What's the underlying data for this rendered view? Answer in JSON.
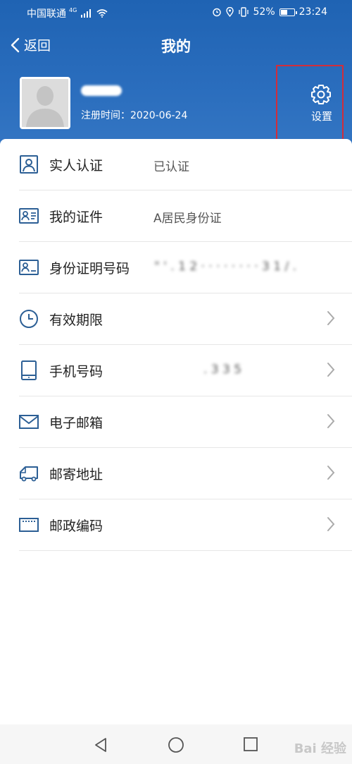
{
  "status_bar": {
    "carrier": "中国联通",
    "network": "4G",
    "battery": "52%",
    "time": "23:24",
    "battery_level": 0.52
  },
  "header": {
    "back_label": "返回",
    "title": "我的",
    "settings_label": "设置"
  },
  "profile": {
    "reg_label": "注册时间：",
    "reg_date": "2020-06-24"
  },
  "menu": [
    {
      "label": "实人认证",
      "value": "已认证",
      "icon": "person-badge-icon",
      "chevron": false
    },
    {
      "label": "我的证件",
      "value": "A居民身份证",
      "icon": "id-card-icon",
      "chevron": false
    },
    {
      "label": "身份证明号码",
      "value": "\" ' . 1 2 · · · · · · · · 3 1 / .",
      "icon": "id-number-icon",
      "chevron": false
    },
    {
      "label": "有效期限",
      "value": "",
      "icon": "clock-icon",
      "chevron": true
    },
    {
      "label": "手机号码",
      "value": ". 3 3 5",
      "icon": "phone-icon",
      "chevron": true
    },
    {
      "label": "电子邮箱",
      "value": "",
      "icon": "mail-icon",
      "chevron": true
    },
    {
      "label": "邮寄地址",
      "value": "",
      "icon": "truck-icon",
      "chevron": true
    },
    {
      "label": "邮政编码",
      "value": "",
      "icon": "postcode-icon",
      "chevron": true
    }
  ],
  "watermark": "Bai 经验",
  "colors": {
    "header_blue": "#2a6dbd",
    "icon_blue": "#2c5f95",
    "highlight_red": "#d22d3a"
  }
}
